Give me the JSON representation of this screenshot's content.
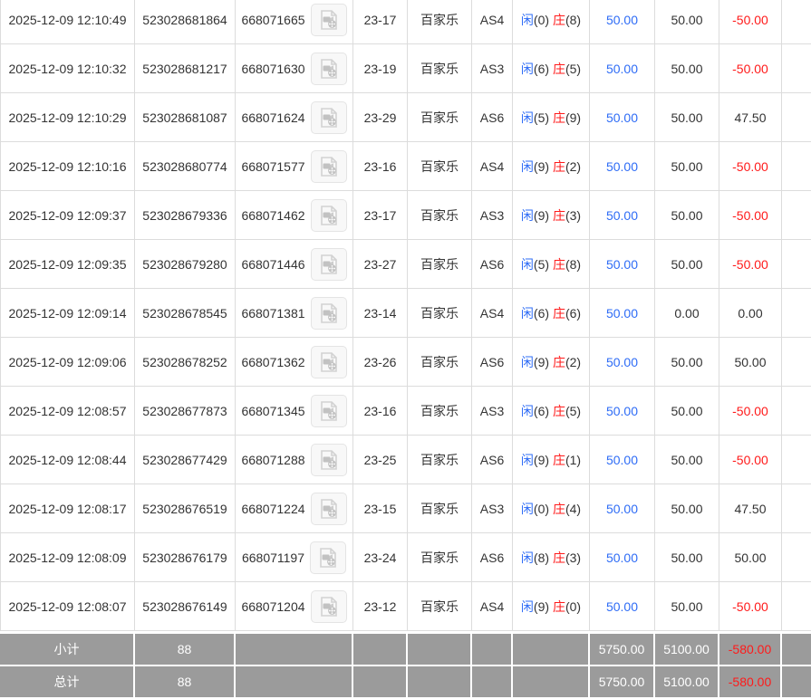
{
  "colors": {
    "blue_amount": "#2e6cf6",
    "red_amount": "#ff1a1a",
    "text": "#333333",
    "grid_border": "#dcdcdc",
    "summary_background": "#9b9b9b",
    "summary_text": "#ffffff"
  },
  "icons": {
    "video_replay": "video-document-icon"
  },
  "table": {
    "rows": [
      {
        "time": "2025-12-09 12:10:49",
        "order_id": "523028681864",
        "round_id": "668071665",
        "table_round": "23-17",
        "game": "百家乐",
        "table_code": "AS4",
        "player_label": "闲",
        "player_score": "(0)",
        "banker_label": "庄",
        "banker_score": "(8)",
        "valid_bet": "50.00",
        "bet_amount": "50.00",
        "win_loss": "-50.00"
      },
      {
        "time": "2025-12-09 12:10:32",
        "order_id": "523028681217",
        "round_id": "668071630",
        "table_round": "23-19",
        "game": "百家乐",
        "table_code": "AS3",
        "player_label": "闲",
        "player_score": "(6)",
        "banker_label": "庄",
        "banker_score": "(5)",
        "valid_bet": "50.00",
        "bet_amount": "50.00",
        "win_loss": "-50.00"
      },
      {
        "time": "2025-12-09 12:10:29",
        "order_id": "523028681087",
        "round_id": "668071624",
        "table_round": "23-29",
        "game": "百家乐",
        "table_code": "AS6",
        "player_label": "闲",
        "player_score": "(5)",
        "banker_label": "庄",
        "banker_score": "(9)",
        "valid_bet": "50.00",
        "bet_amount": "50.00",
        "win_loss": "47.50"
      },
      {
        "time": "2025-12-09 12:10:16",
        "order_id": "523028680774",
        "round_id": "668071577",
        "table_round": "23-16",
        "game": "百家乐",
        "table_code": "AS4",
        "player_label": "闲",
        "player_score": "(9)",
        "banker_label": "庄",
        "banker_score": "(2)",
        "valid_bet": "50.00",
        "bet_amount": "50.00",
        "win_loss": "-50.00"
      },
      {
        "time": "2025-12-09 12:09:37",
        "order_id": "523028679336",
        "round_id": "668071462",
        "table_round": "23-17",
        "game": "百家乐",
        "table_code": "AS3",
        "player_label": "闲",
        "player_score": "(9)",
        "banker_label": "庄",
        "banker_score": "(3)",
        "valid_bet": "50.00",
        "bet_amount": "50.00",
        "win_loss": "-50.00"
      },
      {
        "time": "2025-12-09 12:09:35",
        "order_id": "523028679280",
        "round_id": "668071446",
        "table_round": "23-27",
        "game": "百家乐",
        "table_code": "AS6",
        "player_label": "闲",
        "player_score": "(5)",
        "banker_label": "庄",
        "banker_score": "(8)",
        "valid_bet": "50.00",
        "bet_amount": "50.00",
        "win_loss": "-50.00"
      },
      {
        "time": "2025-12-09 12:09:14",
        "order_id": "523028678545",
        "round_id": "668071381",
        "table_round": "23-14",
        "game": "百家乐",
        "table_code": "AS4",
        "player_label": "闲",
        "player_score": "(6)",
        "banker_label": "庄",
        "banker_score": "(6)",
        "valid_bet": "50.00",
        "bet_amount": "0.00",
        "win_loss": "0.00"
      },
      {
        "time": "2025-12-09 12:09:06",
        "order_id": "523028678252",
        "round_id": "668071362",
        "table_round": "23-26",
        "game": "百家乐",
        "table_code": "AS6",
        "player_label": "闲",
        "player_score": "(9)",
        "banker_label": "庄",
        "banker_score": "(2)",
        "valid_bet": "50.00",
        "bet_amount": "50.00",
        "win_loss": "50.00"
      },
      {
        "time": "2025-12-09 12:08:57",
        "order_id": "523028677873",
        "round_id": "668071345",
        "table_round": "23-16",
        "game": "百家乐",
        "table_code": "AS3",
        "player_label": "闲",
        "player_score": "(6)",
        "banker_label": "庄",
        "banker_score": "(5)",
        "valid_bet": "50.00",
        "bet_amount": "50.00",
        "win_loss": "-50.00"
      },
      {
        "time": "2025-12-09 12:08:44",
        "order_id": "523028677429",
        "round_id": "668071288",
        "table_round": "23-25",
        "game": "百家乐",
        "table_code": "AS6",
        "player_label": "闲",
        "player_score": "(9)",
        "banker_label": "庄",
        "banker_score": "(1)",
        "valid_bet": "50.00",
        "bet_amount": "50.00",
        "win_loss": "-50.00"
      },
      {
        "time": "2025-12-09 12:08:17",
        "order_id": "523028676519",
        "round_id": "668071224",
        "table_round": "23-15",
        "game": "百家乐",
        "table_code": "AS3",
        "player_label": "闲",
        "player_score": "(0)",
        "banker_label": "庄",
        "banker_score": "(4)",
        "valid_bet": "50.00",
        "bet_amount": "50.00",
        "win_loss": "47.50"
      },
      {
        "time": "2025-12-09 12:08:09",
        "order_id": "523028676179",
        "round_id": "668071197",
        "table_round": "23-24",
        "game": "百家乐",
        "table_code": "AS6",
        "player_label": "闲",
        "player_score": "(8)",
        "banker_label": "庄",
        "banker_score": "(3)",
        "valid_bet": "50.00",
        "bet_amount": "50.00",
        "win_loss": "50.00"
      },
      {
        "time": "2025-12-09 12:08:07",
        "order_id": "523028676149",
        "round_id": "668071204",
        "table_round": "23-12",
        "game": "百家乐",
        "table_code": "AS4",
        "player_label": "闲",
        "player_score": "(9)",
        "banker_label": "庄",
        "banker_score": "(0)",
        "valid_bet": "50.00",
        "bet_amount": "50.00",
        "win_loss": "-50.00"
      }
    ]
  },
  "summary": {
    "subtotal": {
      "label": "小计",
      "count": "88",
      "valid_bet": "5750.00",
      "bet_amount": "5100.00",
      "win_loss": "-580.00"
    },
    "total": {
      "label": "总计",
      "count": "88",
      "valid_bet": "5750.00",
      "bet_amount": "5100.00",
      "win_loss": "-580.00"
    }
  }
}
